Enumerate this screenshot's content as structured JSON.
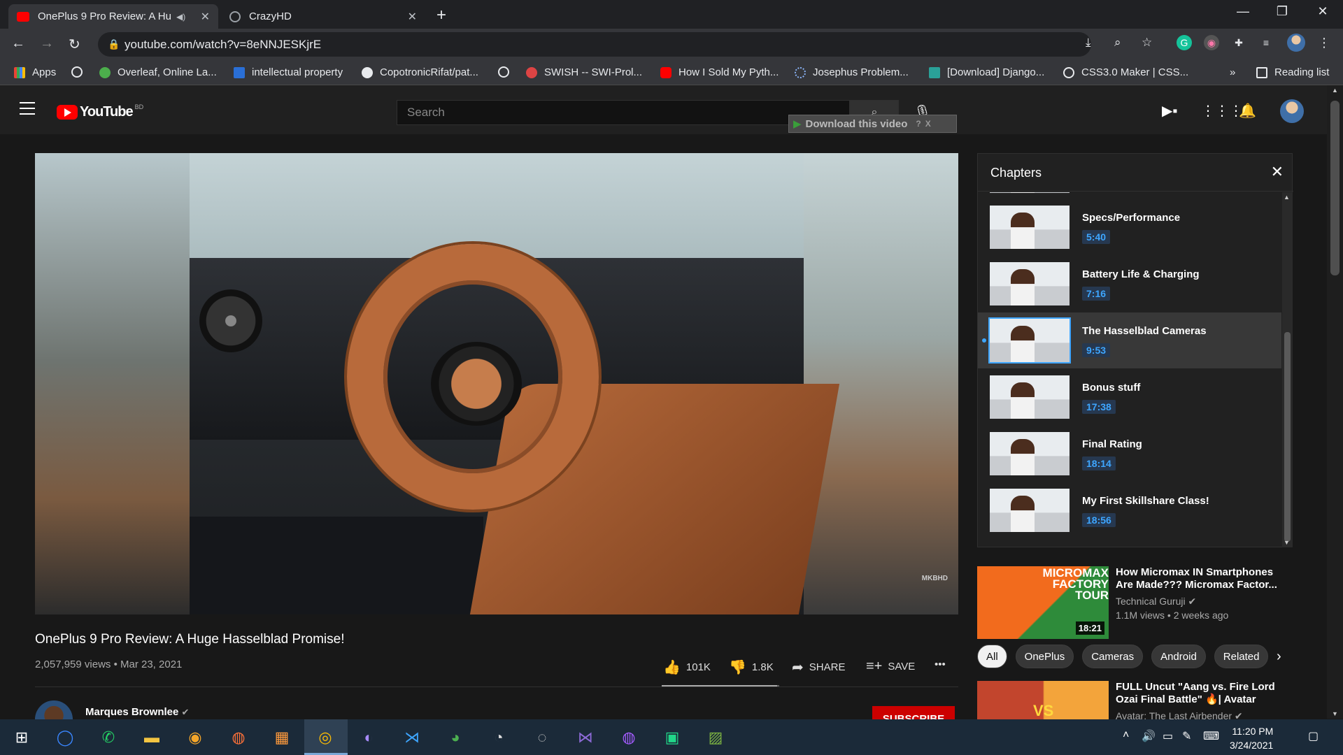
{
  "browser": {
    "tabs": [
      {
        "title": "OnePlus 9 Pro Review: A Hug",
        "active": true,
        "icon": "youtube-icon",
        "audio": true
      },
      {
        "title": "CrazyHD",
        "active": false,
        "icon": "globe-icon"
      }
    ],
    "url": "youtube.com/watch?v=8eNNJESKjrE",
    "bookmarks": [
      {
        "label": "Apps",
        "icon": "apps-grid-icon"
      },
      {
        "label": "",
        "icon": "globe-icon"
      },
      {
        "label": "Overleaf, Online La...",
        "icon": "overleaf-icon"
      },
      {
        "label": "intellectual property",
        "icon": "s-icon"
      },
      {
        "label": "CopotronicRifat/pat...",
        "icon": "github-icon"
      },
      {
        "label": "",
        "icon": "globe-icon"
      },
      {
        "label": "SWISH -- SWI-Prol...",
        "icon": "swish-icon"
      },
      {
        "label": "How I Sold My Pyth...",
        "icon": "youtube-icon"
      },
      {
        "label": "Josephus Problem...",
        "icon": "loading-icon"
      },
      {
        "label": "[Download] Django...",
        "icon": "django-icon"
      },
      {
        "label": "CSS3.0 Maker | CSS...",
        "icon": "globe-icon"
      }
    ],
    "overflow": "»",
    "reading_list": "Reading list"
  },
  "youtube": {
    "logo": "YouTube",
    "country": "BD",
    "search_placeholder": "Search",
    "download_bar": "Download this video",
    "download_help": "?",
    "download_close": "X"
  },
  "video": {
    "title": "OnePlus 9 Pro Review: A Huge Hasselblad Promise!",
    "views_date": "2,057,959 views • Mar 23, 2021",
    "likes": "101K",
    "dislikes": "1.8K",
    "like_ratio": 0.98,
    "share": "SHARE",
    "save": "SAVE",
    "more": "•••",
    "watermark": "MKBHD",
    "channel": "Marques Brownlee",
    "subscribe": "SUBSCRIBE"
  },
  "chapters": {
    "title": "Chapters",
    "items": [
      {
        "name": "Specs/Performance",
        "time": "5:40",
        "active": false
      },
      {
        "name": "Battery Life & Charging",
        "time": "7:16",
        "active": false
      },
      {
        "name": "The Hasselblad Cameras",
        "time": "9:53",
        "active": true
      },
      {
        "name": "Bonus stuff",
        "time": "17:38",
        "active": false
      },
      {
        "name": "Final Rating",
        "time": "18:14",
        "active": false
      },
      {
        "name": "My First Skillshare Class!",
        "time": "18:56",
        "active": false
      }
    ]
  },
  "recommendations": [
    {
      "title": "How Micromax IN Smartphones Are Made??? Micromax Factor...",
      "channel": "Technical Guruji",
      "views": "1.1M views • 2 weeks ago",
      "duration": "18:21",
      "thumb_text": "MICROMAX FACTORY TOUR"
    },
    {
      "title": "FULL Uncut \"Aang vs. Fire Lord Ozai Final Battle\" 🔥| Avatar",
      "channel": "Avatar: The Last Airbender",
      "views": "",
      "duration": "",
      "thumb_text": "VS"
    }
  ],
  "chips": [
    "All",
    "OnePlus",
    "Cameras",
    "Android",
    "Related"
  ],
  "taskbar": {
    "time": "11:20 PM",
    "date": "3/24/2021"
  },
  "colors": {
    "accent": "#3ea6ff",
    "youtube_red": "#ff0000",
    "subscribe_red": "#cc0000"
  }
}
